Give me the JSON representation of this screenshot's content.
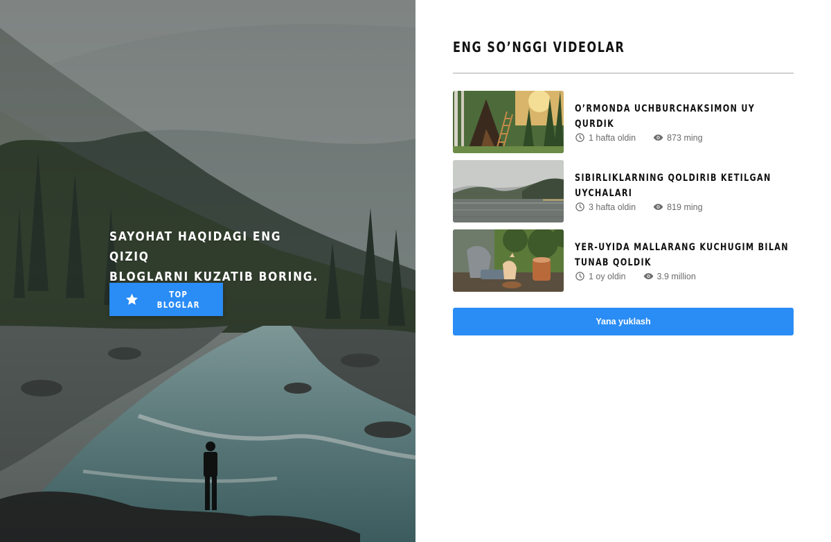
{
  "hero": {
    "title_line1": "SAYOHAT HAQIDAGI ENG QIZIQ",
    "title_line2": "BLOGLARNI KUZATIB BORING.",
    "button_label": "TOP BLOGLAR",
    "button_icon": "star-icon"
  },
  "latest": {
    "heading": "ENG SO’NGGI VIDEOLAR",
    "videos": [
      {
        "title_line1": "O’RMONDA UCHBURCHAKSIMON UY QURDIK",
        "title_line2": "",
        "time": "1 hafta oldin",
        "views": "873 ming",
        "thumbnail": "a-frame-cabin-forest"
      },
      {
        "title_line1": "SIBIRLIKLARNING QOLDIRIB KETILGAN",
        "title_line2": "UYCHALARI",
        "time": "3 hafta oldin",
        "views": "819 ming",
        "thumbnail": "siberian-lake-mountains"
      },
      {
        "title_line1": "YER-UYIDA MALLARANG KUCHUGIM BILAN",
        "title_line2": "TUNAB QOLDIK",
        "time": "1 oy oldin",
        "views": "3.9 million",
        "thumbnail": "campfire-with-dog"
      }
    ],
    "load_more_label": "Yana yuklash"
  },
  "colors": {
    "accent": "#2a8cf5",
    "title_text": "#111111",
    "meta_text": "#6b6b6b"
  }
}
